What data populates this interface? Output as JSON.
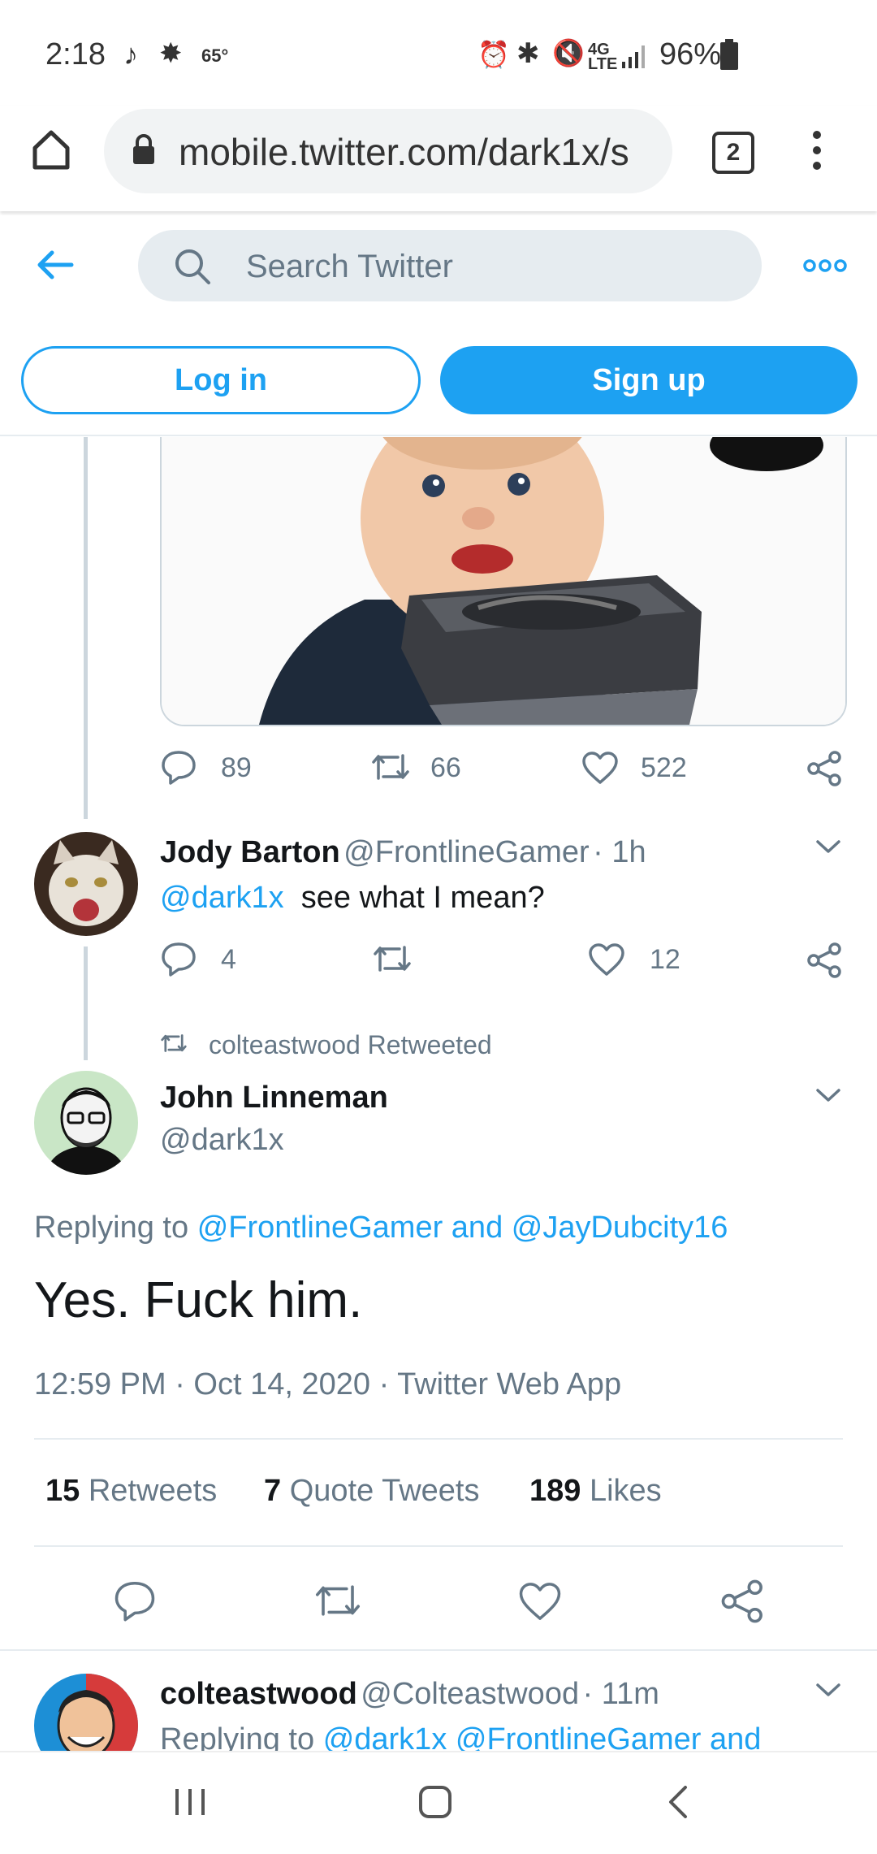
{
  "status_bar": {
    "time": "2:18",
    "temperature": "65°",
    "battery": "96%",
    "icons": [
      "tiktok-icon",
      "weather-icon",
      "alarm-icon",
      "bluetooth-icon",
      "mute-icon",
      "lte-icon",
      "signal-icon",
      "battery-icon"
    ]
  },
  "browser": {
    "url": "mobile.twitter.com/dark1x/s",
    "tab_count": "2"
  },
  "twitter_header": {
    "search_placeholder": "Search Twitter",
    "login_label": "Log in",
    "signup_label": "Sign up"
  },
  "first_tweet_actions": {
    "replies": "89",
    "retweets": "66",
    "likes": "522"
  },
  "reply_tweet": {
    "name": "Jody Barton",
    "handle": "@FrontlineGamer",
    "time": "· 1h",
    "mention": "@dark1x",
    "text": "see what I mean?",
    "replies": "4",
    "likes": "12"
  },
  "retweet_context": {
    "text": "colteastwood Retweeted"
  },
  "main_tweet": {
    "name": "John Linneman",
    "handle": "@dark1x",
    "replying_prefix": "Replying to",
    "replying_to": "@FrontlineGamer and @JayDubcity16",
    "text": "Yes. Fuck him.",
    "timestamp": "12:59 PM · Oct 14, 2020 · Twitter Web App",
    "retweets_count": "15",
    "retweets_label": "Retweets",
    "quotes_count": "7",
    "quotes_label": "Quote Tweets",
    "likes_count": "189",
    "likes_label": "Likes"
  },
  "next_tweet": {
    "name": "colteastwood",
    "handle": "@Colteastwood",
    "time": "· 11m",
    "replying_prefix": "Replying to",
    "replying_to": "@dark1x @FrontlineGamer and"
  },
  "colors": {
    "accent": "#1da1f2",
    "muted": "#657786",
    "border": "#e6ecf0"
  }
}
